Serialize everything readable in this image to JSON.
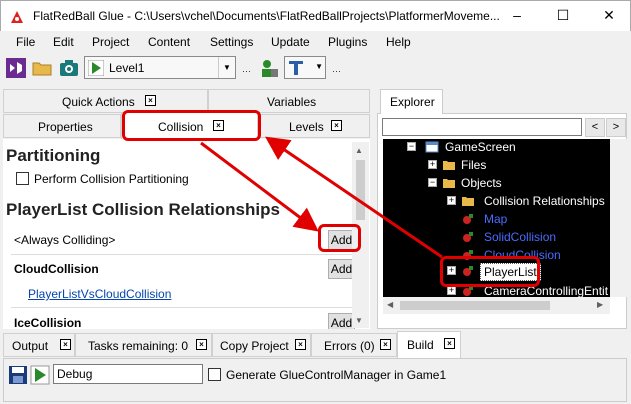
{
  "window": {
    "title": "FlatRedBall Glue - C:\\Users\\vchel\\Documents\\FlatRedBallProjects\\PlatformerMoveme...",
    "minimize": "–",
    "maximize": "☐",
    "close": "✕"
  },
  "menu": [
    "File",
    "Edit",
    "Project",
    "Content",
    "Settings",
    "Update",
    "Plugins",
    "Help"
  ],
  "toolbar": {
    "level_combo": "Level1"
  },
  "left_tabs": {
    "row1": [
      {
        "label": "Quick Actions",
        "closable": true
      },
      {
        "label": "Variables",
        "closable": false
      }
    ],
    "row2": [
      {
        "label": "Properties",
        "closable": false
      },
      {
        "label": "Collision",
        "closable": true
      },
      {
        "label": "Levels",
        "closable": true
      }
    ]
  },
  "collision_panel": {
    "partitioning_header": "Partitioning",
    "perform_partitioning_label": "Perform Collision Partitioning",
    "relationships_header": "PlayerList Collision Relationships",
    "always_colliding": "<Always Colliding>",
    "add": "Add",
    "cloud_collision": "CloudCollision",
    "cloud_link": "PlayerListVsCloudCollision",
    "ice_collision": "IceCollision"
  },
  "explorer": {
    "tab_label": "Explorer",
    "nav_back": "<",
    "nav_forward": ">",
    "tree": [
      {
        "label": "GameScreen",
        "blue": false
      },
      {
        "label": "Files",
        "blue": false
      },
      {
        "label": "Objects",
        "blue": false
      },
      {
        "label": "Collision Relationships",
        "blue": false
      },
      {
        "label": "Map",
        "blue": true
      },
      {
        "label": "SolidCollision",
        "blue": true
      },
      {
        "label": "CloudCollision",
        "blue": true
      },
      {
        "label": "PlayerList",
        "blue": false
      },
      {
        "label": "CameraControllingEntit",
        "blue": false
      }
    ]
  },
  "bottom_tabs": [
    {
      "label": "Output"
    },
    {
      "label": "Tasks remaining: 0"
    },
    {
      "label": "Copy Project"
    },
    {
      "label": "Errors (0)"
    },
    {
      "label": "Build"
    }
  ],
  "build_panel": {
    "config": "Debug",
    "generate_label": "Generate GlueControlManager in Game1"
  },
  "colors": {
    "annotation_red": "#e00000",
    "tree_background": "#000000",
    "link_blue": "#0645ad"
  }
}
